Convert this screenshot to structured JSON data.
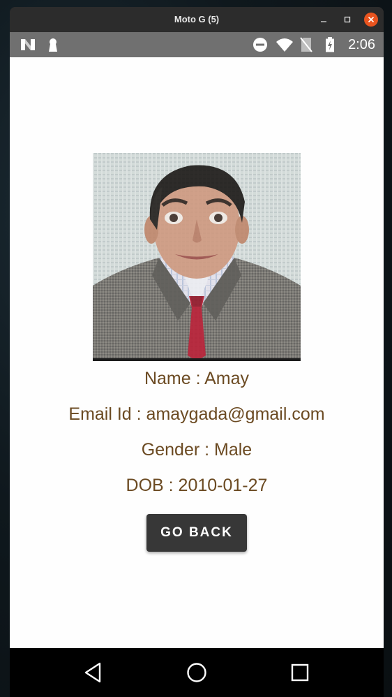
{
  "window": {
    "title": "Moto G (5)",
    "minimize_icon": "minimize-icon",
    "maximize_icon": "maximize-icon",
    "close_icon": "close-icon",
    "close_color": "#e9541f"
  },
  "status_bar": {
    "time": "2:06",
    "background": "#707070",
    "icons": [
      "n-icon",
      "keyhole-icon",
      "do-not-disturb-icon",
      "wifi-icon",
      "no-sim-icon",
      "battery-icon"
    ]
  },
  "profile": {
    "photo_icon": "profile-photo",
    "name_line": "Name : Amay",
    "email_line": "Email Id : amaygada@gmail.com",
    "gender_line": "Gender : Male",
    "dob_line": "DOB : 2010-01-27",
    "text_color": "#6b4a22"
  },
  "actions": {
    "go_back_label": "GO BACK",
    "button_color": "#373737"
  },
  "nav_bar": {
    "icons": [
      "back-triangle-icon",
      "home-circle-icon",
      "recents-square-icon"
    ]
  }
}
